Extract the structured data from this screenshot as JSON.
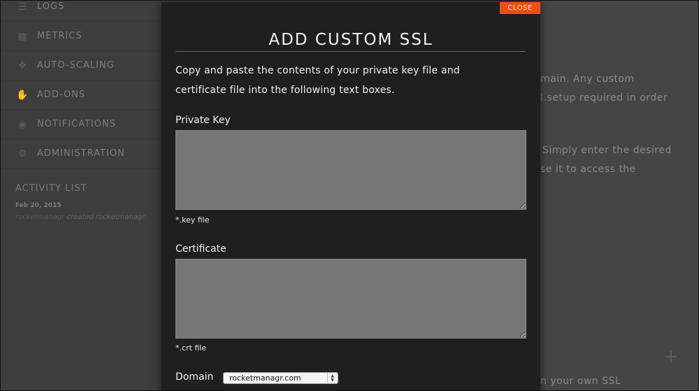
{
  "sidebar": {
    "items": [
      {
        "label": "LOGS",
        "icon": "logs-icon"
      },
      {
        "label": "METRICS",
        "icon": "metrics-icon"
      },
      {
        "label": "AUTO-SCALING",
        "icon": "auto-scaling-icon"
      },
      {
        "label": "ADD-ONS",
        "icon": "add-ons-icon"
      },
      {
        "label": "NOTIFICATIONS",
        "icon": "notifications-icon"
      },
      {
        "label": "ADMINISTRATION",
        "icon": "administration-icon"
      }
    ],
    "activity": {
      "title": "ACTIVITY LIST",
      "date": "Feb 20, 2015",
      "entry_user": "rocketmanagr",
      "entry_text": " created rocketmanagr."
    }
  },
  "background": {
    "line1": "main. Any custom",
    "line2_link": "l.setup",
    "line2_rest": " required in order",
    "line3": "Simply enter the desired",
    "line4": "se it to access the",
    "line5": "n your own SSL"
  },
  "modal": {
    "close_label": "CLOSE",
    "title": "ADD CUSTOM SSL",
    "intro": "Copy and paste the contents of your private key file and certificate file into the following text boxes.",
    "private_key": {
      "label": "Private Key",
      "value": "",
      "hint": "*.key file"
    },
    "certificate": {
      "label": "Certificate",
      "value": "",
      "hint": "*.crt file"
    },
    "domain": {
      "label": "Domain",
      "selected": "rocketmanagr.com"
    }
  },
  "colors": {
    "close_button": "#e8511d",
    "modal_bg": "#1f1f1f",
    "textarea_bg": "#767676",
    "overlay_bg": "#3f3f3f"
  }
}
